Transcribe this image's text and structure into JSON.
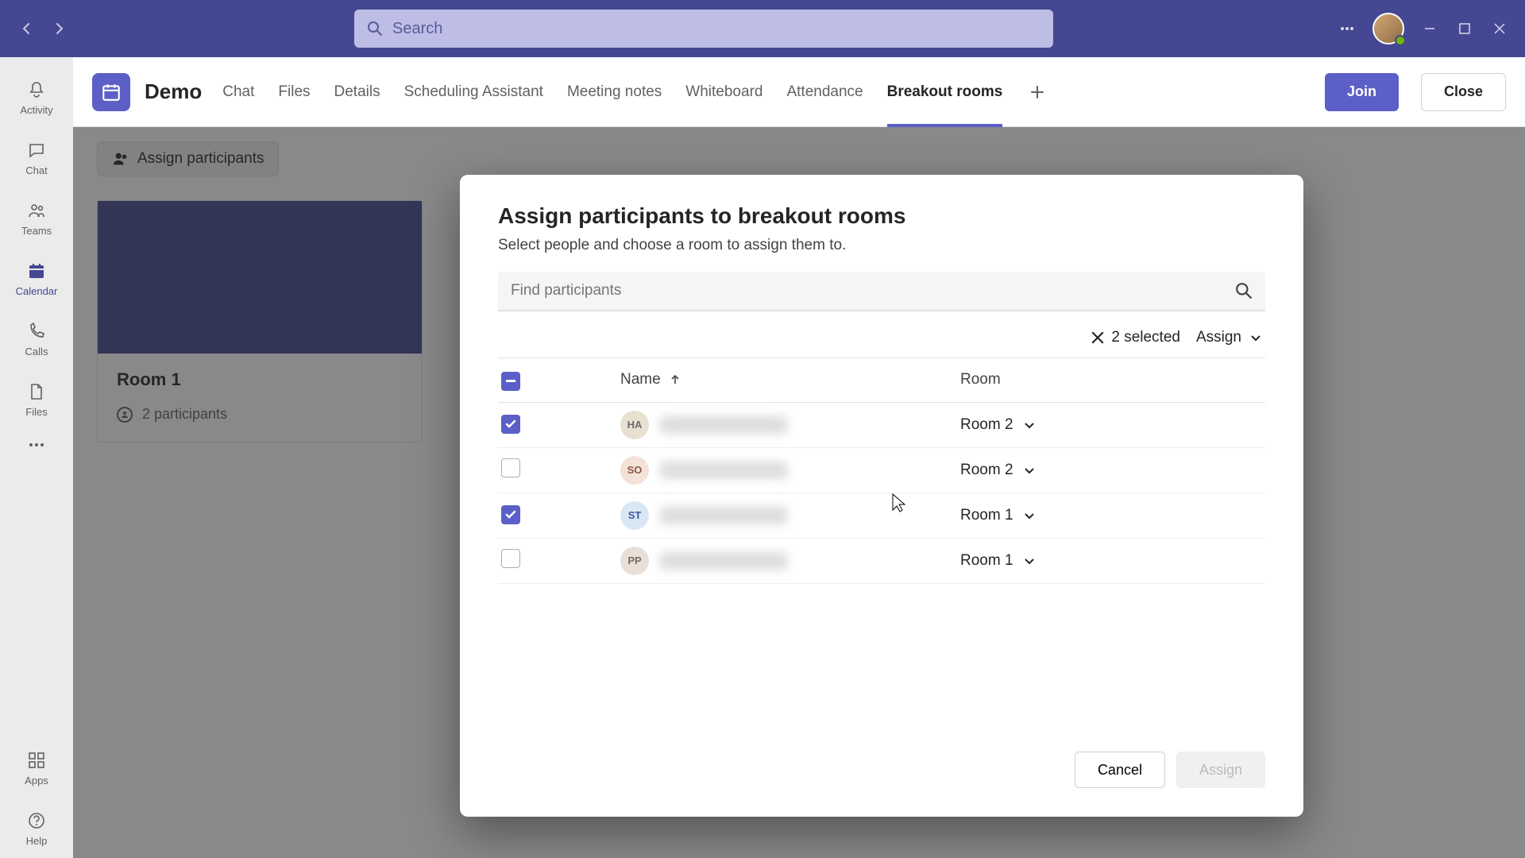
{
  "search": {
    "placeholder": "Search"
  },
  "rail": {
    "items": [
      {
        "label": "Activity"
      },
      {
        "label": "Chat"
      },
      {
        "label": "Teams"
      },
      {
        "label": "Calendar"
      },
      {
        "label": "Calls"
      },
      {
        "label": "Files"
      }
    ],
    "apps": "Apps",
    "help": "Help"
  },
  "header": {
    "title": "Demo",
    "tabs": [
      "Chat",
      "Files",
      "Details",
      "Scheduling Assistant",
      "Meeting notes",
      "Whiteboard",
      "Attendance",
      "Breakout rooms"
    ],
    "active_tab": 7,
    "join": "Join",
    "close": "Close"
  },
  "page": {
    "assign_btn": "Assign participants",
    "room_title": "Room 1",
    "room_participants": "2 participants"
  },
  "dialog": {
    "title": "Assign participants to breakout rooms",
    "subtitle": "Select people and choose a room to assign them to.",
    "find_placeholder": "Find participants",
    "selected_text": "2 selected",
    "assign_label": "Assign",
    "col_name": "Name",
    "col_room": "Room",
    "cancel": "Cancel",
    "assign_btn": "Assign",
    "participants": [
      {
        "initials": "HA",
        "bg": "#e8e0d0",
        "fg": "#6b6b6b",
        "checked": true,
        "room": "Room 2"
      },
      {
        "initials": "SO",
        "bg": "#f4e2d8",
        "fg": "#8a5a44",
        "checked": false,
        "room": "Room 2"
      },
      {
        "initials": "ST",
        "bg": "#d9e7f5",
        "fg": "#3b5998",
        "checked": true,
        "room": "Room 1"
      },
      {
        "initials": "PP",
        "bg": "#e8e0d8",
        "fg": "#7a6a5a",
        "checked": false,
        "room": "Room 1"
      }
    ]
  }
}
